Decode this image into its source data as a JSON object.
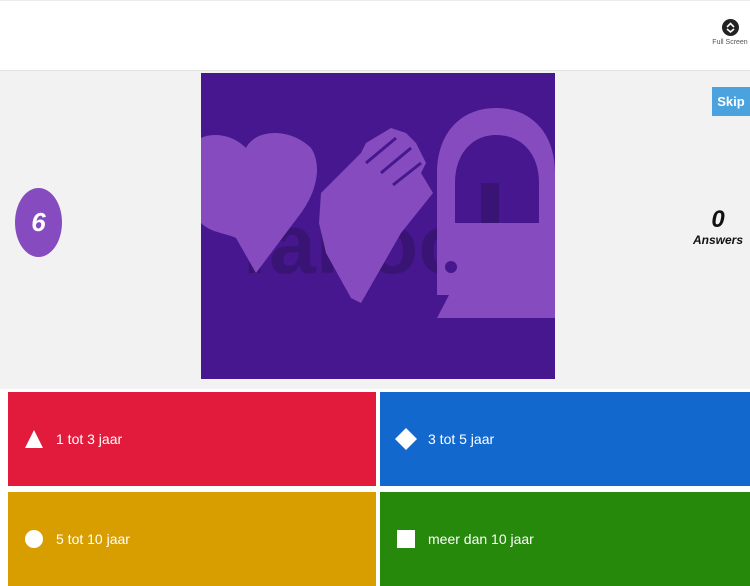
{
  "header": {
    "fullscreen_label": "Full Screen",
    "fullscreen_icon": "fullscreen-icon"
  },
  "question": {
    "timer": "6",
    "answers_count": "0",
    "answers_label": "Answers",
    "skip_label": "Skip"
  },
  "answers": [
    {
      "shape": "triangle-icon",
      "label": "1 tot 3 jaar",
      "color": "#e21b3c"
    },
    {
      "shape": "diamond-icon",
      "label": "3 tot 5 jaar",
      "color": "#1368ce"
    },
    {
      "shape": "circle-icon",
      "label": "5 tot 10 jaar",
      "color": "#d89e00"
    },
    {
      "shape": "square-icon",
      "label": "meer dan 10 jaar",
      "color": "#26890c"
    }
  ],
  "colors": {
    "timer_bg": "#864cbf",
    "media_bg": "#46178f",
    "skip_bg": "#4aa3df"
  }
}
